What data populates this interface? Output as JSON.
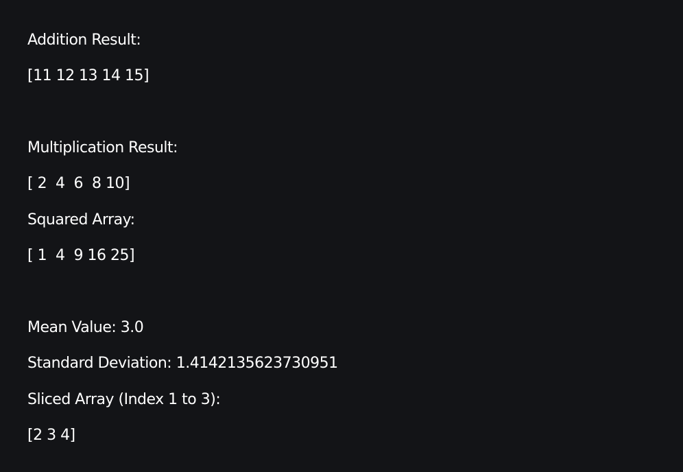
{
  "output": {
    "lines": [
      "Addition Result:",
      "[11 12 13 14 15]",
      "Multiplication Result:",
      "[ 2  4  6  8 10]",
      "Squared Array:",
      "[ 1  4  9 16 25]",
      "Mean Value: 3.0",
      "Standard Deviation: 1.4142135623730951",
      "Sliced Array (Index 1 to 3):",
      "[2 3 4]"
    ]
  }
}
